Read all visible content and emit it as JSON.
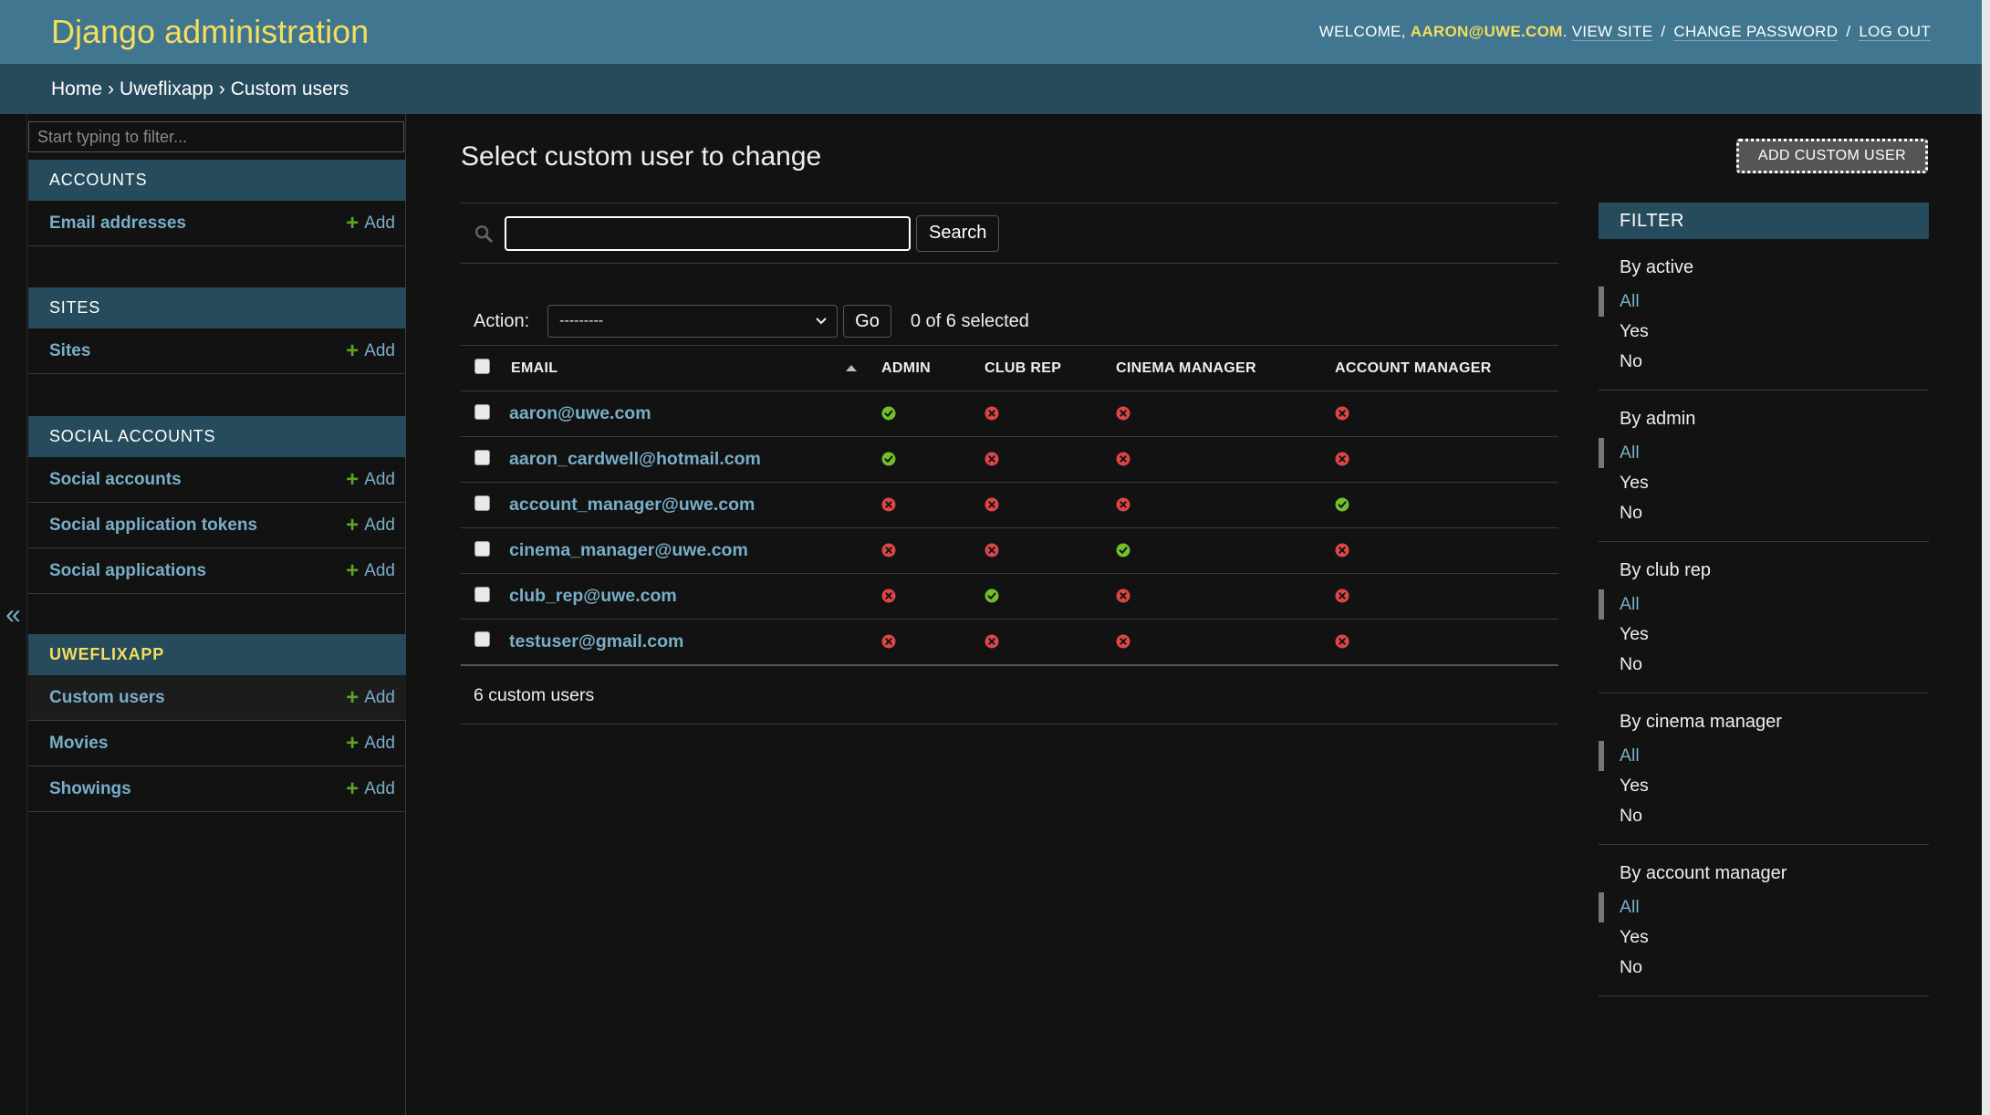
{
  "header": {
    "site_title": "Django administration",
    "welcome": "WELCOME,",
    "username": "AARON@UWE.COM",
    "period": ".",
    "view_site": "VIEW SITE",
    "change_password": "CHANGE PASSWORD",
    "logout": "LOG OUT",
    "separator": "/"
  },
  "breadcrumbs": {
    "home": "Home",
    "app": "Uweflixapp",
    "current": "Custom users",
    "separator": "›"
  },
  "sidebar": {
    "collapse_icon": "«",
    "filter_placeholder": "Start typing to filter...",
    "add_label": "Add",
    "apps": [
      {
        "caption": "ACCOUNTS",
        "models": [
          "Email addresses"
        ]
      },
      {
        "caption": "SITES",
        "models": [
          "Sites"
        ]
      },
      {
        "caption": "SOCIAL ACCOUNTS",
        "models": [
          "Social accounts",
          "Social application tokens",
          "Social applications"
        ]
      },
      {
        "caption": "UWEFLIXAPP",
        "models": [
          "Custom users",
          "Movies",
          "Showings"
        ],
        "current": true
      }
    ]
  },
  "main": {
    "title": "Select custom user to change",
    "add_button": "ADD CUSTOM USER",
    "search_button": "Search",
    "search_value": "",
    "action_label": "Action:",
    "action_selected": "---------",
    "go_button": "Go",
    "selected_count": "0 of 6 selected",
    "columns": [
      "EMAIL",
      "ADMIN",
      "CLUB REP",
      "CINEMA MANAGER",
      "ACCOUNT MANAGER"
    ],
    "rows": [
      {
        "email": "aaron@uwe.com",
        "admin": true,
        "club_rep": false,
        "cinema_manager": false,
        "account_manager": false
      },
      {
        "email": "aaron_cardwell@hotmail.com",
        "admin": true,
        "club_rep": false,
        "cinema_manager": false,
        "account_manager": false
      },
      {
        "email": "account_manager@uwe.com",
        "admin": false,
        "club_rep": false,
        "cinema_manager": false,
        "account_manager": true
      },
      {
        "email": "cinema_manager@uwe.com",
        "admin": false,
        "club_rep": false,
        "cinema_manager": true,
        "account_manager": false
      },
      {
        "email": "club_rep@uwe.com",
        "admin": false,
        "club_rep": true,
        "cinema_manager": false,
        "account_manager": false
      },
      {
        "email": "testuser@gmail.com",
        "admin": false,
        "club_rep": false,
        "cinema_manager": false,
        "account_manager": false
      }
    ],
    "paginator": "6 custom users"
  },
  "filter": {
    "title": "FILTER",
    "groups": [
      {
        "title": "By active",
        "options": [
          "All",
          "Yes",
          "No"
        ],
        "selected": "All"
      },
      {
        "title": "By admin",
        "options": [
          "All",
          "Yes",
          "No"
        ],
        "selected": "All"
      },
      {
        "title": "By club rep",
        "options": [
          "All",
          "Yes",
          "No"
        ],
        "selected": "All"
      },
      {
        "title": "By cinema manager",
        "options": [
          "All",
          "Yes",
          "No"
        ],
        "selected": "All"
      },
      {
        "title": "By account manager",
        "options": [
          "All",
          "Yes",
          "No"
        ],
        "selected": "All"
      }
    ]
  },
  "colors": {
    "header_bg": "#417690",
    "breadcrumb_bg": "#264b5d",
    "accent_yellow": "#f5dd5d",
    "link_blue": "#79aec8",
    "yes_green": "#70bf2b",
    "no_red": "#dd4646"
  },
  "icons": {
    "search": "search-icon",
    "yes": "check-circle-icon",
    "no": "x-circle-icon",
    "add": "plus-icon",
    "sort": "sort-ascending-icon",
    "dropdown": "chevron-down-icon"
  }
}
